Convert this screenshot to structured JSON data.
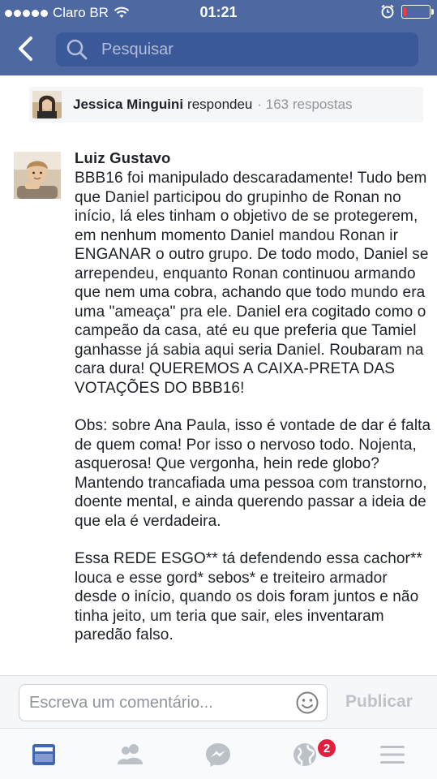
{
  "status_bar": {
    "carrier": "Claro BR",
    "time": "01:21",
    "battery_percent": 10
  },
  "nav": {
    "search_placeholder": "Pesquisar",
    "icons": [
      "back-arrow-icon",
      "search-icon"
    ]
  },
  "reply_summary": {
    "name": "Jessica Minguini",
    "verb": "respondeu",
    "count": "· 163 respostas"
  },
  "comment": {
    "author": "Luiz Gustavo",
    "paragraphs": [
      "BBB16 foi manipulado descaradamente! Tudo bem que Daniel participou do grupinho de Ronan no início, lá eles tinham o objetivo de se protegerem, em nenhum momento Daniel mandou Ronan ir ENGANAR o outro grupo. De todo modo, Daniel se arrependeu, enquanto Ronan continuou armando que nem uma cobra, achando que todo mundo era uma \"ameaça\" pra ele. Daniel era cogitado como o campeão da casa, até eu que preferia que Tamiel ganhasse já sabia aqui seria Daniel. Roubaram na cara dura! QUEREMOS A CAIXA-PRETA DAS VOTAÇÕES DO BBB16!",
      "Obs: sobre Ana Paula, isso é vontade de dar é falta de quem coma! Por isso o nervoso todo. Nojenta, asquerosa! Que vergonha, hein rede globo? Mantendo trancafiada uma pessoa com transtorno, doente mental, e ainda querendo passar a ideia de que ela é verdadeira.",
      "Essa REDE ESGO** tá defendendo essa cachor** louca e esse gord* sebos* e treiteiro armador desde o início, quando os dois foram juntos e não tinha jeito, um teria que sair, eles inventaram paredão falso."
    ]
  },
  "composer": {
    "placeholder": "Escreva um comentário...",
    "publish_label": "Publicar"
  },
  "tabbar": {
    "tabs": [
      "news-feed-icon",
      "friends-icon",
      "messenger-icon",
      "notifications-globe-icon",
      "menu-icon"
    ],
    "notifications_badge": "2",
    "active_color": "#4267b2",
    "inactive_color": "#bcc0c7"
  },
  "colors": {
    "header": "#4e69a2",
    "search_field": "#3b5998",
    "badge": "#e41e3f"
  }
}
